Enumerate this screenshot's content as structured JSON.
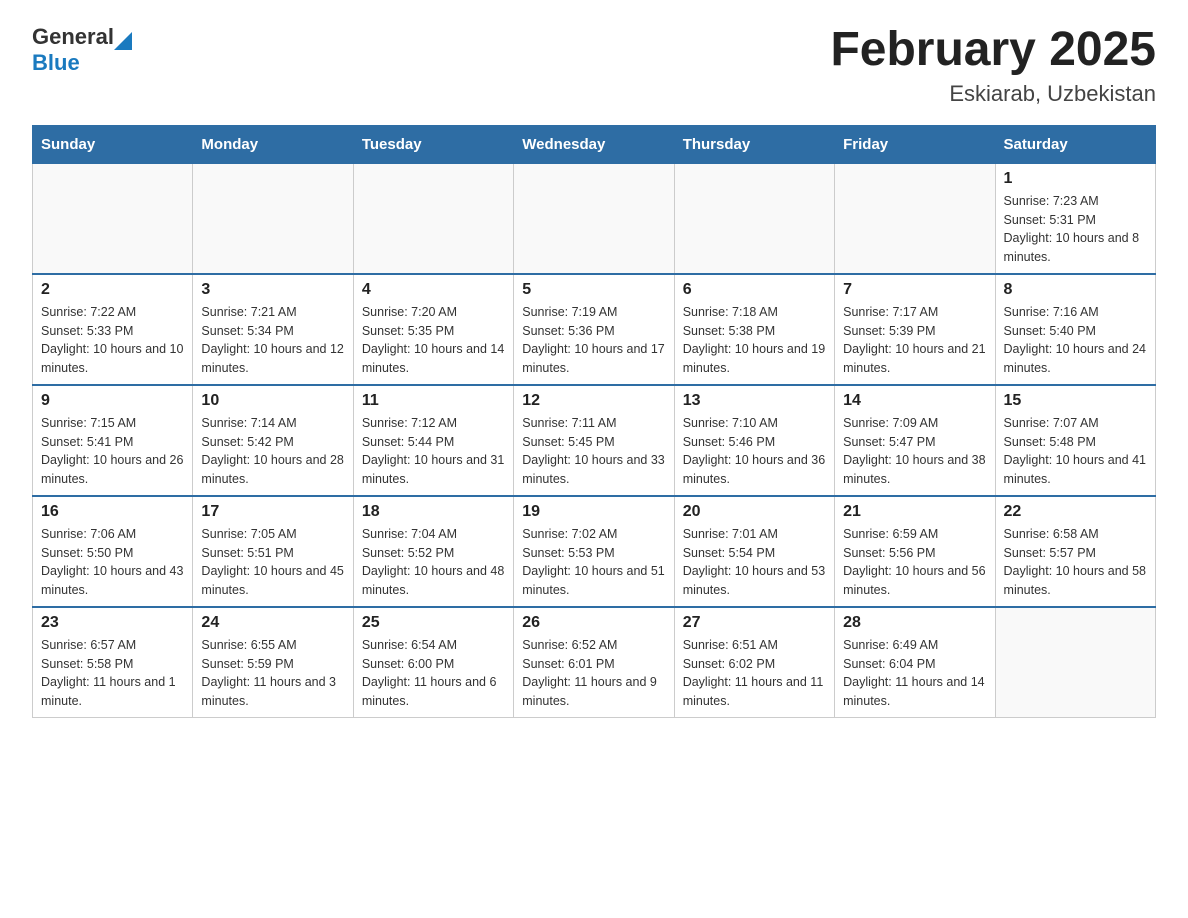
{
  "header": {
    "title": "February 2025",
    "subtitle": "Eskiarab, Uzbekistan"
  },
  "logo": {
    "general": "General",
    "blue": "Blue"
  },
  "weekdays": [
    "Sunday",
    "Monday",
    "Tuesday",
    "Wednesday",
    "Thursday",
    "Friday",
    "Saturday"
  ],
  "weeks": [
    [
      {
        "day": "",
        "info": ""
      },
      {
        "day": "",
        "info": ""
      },
      {
        "day": "",
        "info": ""
      },
      {
        "day": "",
        "info": ""
      },
      {
        "day": "",
        "info": ""
      },
      {
        "day": "",
        "info": ""
      },
      {
        "day": "1",
        "info": "Sunrise: 7:23 AM\nSunset: 5:31 PM\nDaylight: 10 hours and 8 minutes."
      }
    ],
    [
      {
        "day": "2",
        "info": "Sunrise: 7:22 AM\nSunset: 5:33 PM\nDaylight: 10 hours and 10 minutes."
      },
      {
        "day": "3",
        "info": "Sunrise: 7:21 AM\nSunset: 5:34 PM\nDaylight: 10 hours and 12 minutes."
      },
      {
        "day": "4",
        "info": "Sunrise: 7:20 AM\nSunset: 5:35 PM\nDaylight: 10 hours and 14 minutes."
      },
      {
        "day": "5",
        "info": "Sunrise: 7:19 AM\nSunset: 5:36 PM\nDaylight: 10 hours and 17 minutes."
      },
      {
        "day": "6",
        "info": "Sunrise: 7:18 AM\nSunset: 5:38 PM\nDaylight: 10 hours and 19 minutes."
      },
      {
        "day": "7",
        "info": "Sunrise: 7:17 AM\nSunset: 5:39 PM\nDaylight: 10 hours and 21 minutes."
      },
      {
        "day": "8",
        "info": "Sunrise: 7:16 AM\nSunset: 5:40 PM\nDaylight: 10 hours and 24 minutes."
      }
    ],
    [
      {
        "day": "9",
        "info": "Sunrise: 7:15 AM\nSunset: 5:41 PM\nDaylight: 10 hours and 26 minutes."
      },
      {
        "day": "10",
        "info": "Sunrise: 7:14 AM\nSunset: 5:42 PM\nDaylight: 10 hours and 28 minutes."
      },
      {
        "day": "11",
        "info": "Sunrise: 7:12 AM\nSunset: 5:44 PM\nDaylight: 10 hours and 31 minutes."
      },
      {
        "day": "12",
        "info": "Sunrise: 7:11 AM\nSunset: 5:45 PM\nDaylight: 10 hours and 33 minutes."
      },
      {
        "day": "13",
        "info": "Sunrise: 7:10 AM\nSunset: 5:46 PM\nDaylight: 10 hours and 36 minutes."
      },
      {
        "day": "14",
        "info": "Sunrise: 7:09 AM\nSunset: 5:47 PM\nDaylight: 10 hours and 38 minutes."
      },
      {
        "day": "15",
        "info": "Sunrise: 7:07 AM\nSunset: 5:48 PM\nDaylight: 10 hours and 41 minutes."
      }
    ],
    [
      {
        "day": "16",
        "info": "Sunrise: 7:06 AM\nSunset: 5:50 PM\nDaylight: 10 hours and 43 minutes."
      },
      {
        "day": "17",
        "info": "Sunrise: 7:05 AM\nSunset: 5:51 PM\nDaylight: 10 hours and 45 minutes."
      },
      {
        "day": "18",
        "info": "Sunrise: 7:04 AM\nSunset: 5:52 PM\nDaylight: 10 hours and 48 minutes."
      },
      {
        "day": "19",
        "info": "Sunrise: 7:02 AM\nSunset: 5:53 PM\nDaylight: 10 hours and 51 minutes."
      },
      {
        "day": "20",
        "info": "Sunrise: 7:01 AM\nSunset: 5:54 PM\nDaylight: 10 hours and 53 minutes."
      },
      {
        "day": "21",
        "info": "Sunrise: 6:59 AM\nSunset: 5:56 PM\nDaylight: 10 hours and 56 minutes."
      },
      {
        "day": "22",
        "info": "Sunrise: 6:58 AM\nSunset: 5:57 PM\nDaylight: 10 hours and 58 minutes."
      }
    ],
    [
      {
        "day": "23",
        "info": "Sunrise: 6:57 AM\nSunset: 5:58 PM\nDaylight: 11 hours and 1 minute."
      },
      {
        "day": "24",
        "info": "Sunrise: 6:55 AM\nSunset: 5:59 PM\nDaylight: 11 hours and 3 minutes."
      },
      {
        "day": "25",
        "info": "Sunrise: 6:54 AM\nSunset: 6:00 PM\nDaylight: 11 hours and 6 minutes."
      },
      {
        "day": "26",
        "info": "Sunrise: 6:52 AM\nSunset: 6:01 PM\nDaylight: 11 hours and 9 minutes."
      },
      {
        "day": "27",
        "info": "Sunrise: 6:51 AM\nSunset: 6:02 PM\nDaylight: 11 hours and 11 minutes."
      },
      {
        "day": "28",
        "info": "Sunrise: 6:49 AM\nSunset: 6:04 PM\nDaylight: 11 hours and 14 minutes."
      },
      {
        "day": "",
        "info": ""
      }
    ]
  ]
}
